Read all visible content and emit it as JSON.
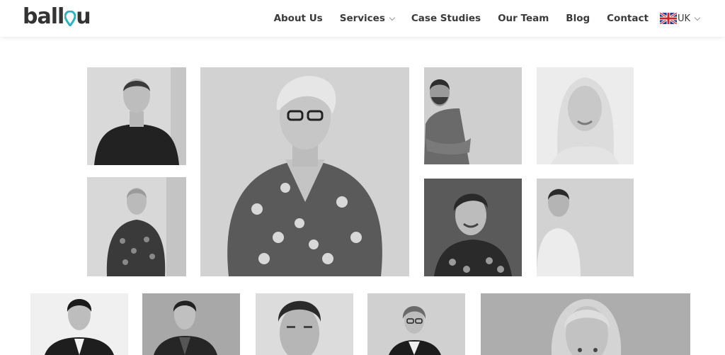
{
  "brand": {
    "logo_text_1": "ball",
    "logo_text_2": "u",
    "accent_color": "#2bb3c0"
  },
  "nav": {
    "items": [
      {
        "label": "About Us",
        "has_dropdown": false
      },
      {
        "label": "Services",
        "has_dropdown": true
      },
      {
        "label": "Case Studies",
        "has_dropdown": false
      },
      {
        "label": "Our Team",
        "has_dropdown": false
      },
      {
        "label": "Blog",
        "has_dropdown": false
      },
      {
        "label": "Contact",
        "has_dropdown": false
      }
    ],
    "language": {
      "label": "UK",
      "flag_icon": "uk-flag-icon"
    }
  },
  "team_photos": [
    {
      "subject": "man-dark-sweater"
    },
    {
      "subject": "woman-glasses-floral-dress"
    },
    {
      "subject": "man-bearded-crossed-arms"
    },
    {
      "subject": "woman-blonde-long-hair"
    },
    {
      "subject": "woman-floral-top"
    },
    {
      "subject": "woman-short-hair-smiling"
    },
    {
      "subject": "man-white-shirt"
    },
    {
      "subject": "man-dark-suit"
    },
    {
      "subject": "man-dark-blazer"
    },
    {
      "subject": "man-close-up"
    },
    {
      "subject": "woman-glasses-dark-jacket"
    },
    {
      "subject": "woman-blonde-close-up"
    }
  ]
}
